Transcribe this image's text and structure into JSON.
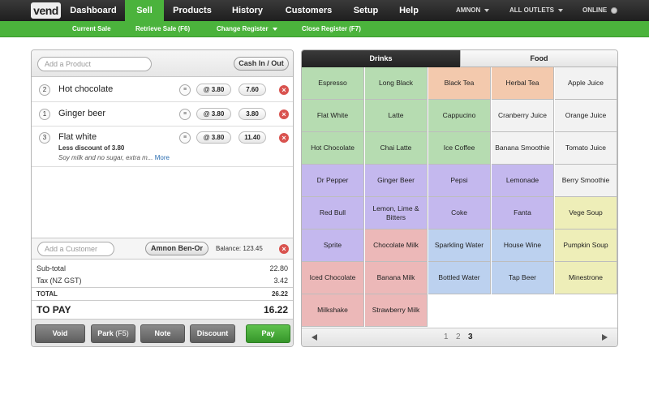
{
  "app": {
    "logo": "vend"
  },
  "nav": {
    "tabs": [
      {
        "label": "Dashboard",
        "active": false
      },
      {
        "label": "Sell",
        "active": true
      },
      {
        "label": "Products",
        "active": false
      },
      {
        "label": "History",
        "active": false
      },
      {
        "label": "Customers",
        "active": false
      },
      {
        "label": "Setup",
        "active": false
      },
      {
        "label": "Help",
        "active": false
      }
    ],
    "user": "AMNON",
    "outlets": "ALL OUTLETS",
    "status": "ONLINE"
  },
  "subnav": {
    "current_sale": "Current Sale",
    "retrieve_sale": "Retrieve Sale (F6)",
    "change_register": "Change Register",
    "close_register": "Close Register (F7)"
  },
  "sale": {
    "product_placeholder": "Add a Product",
    "cash_in_out": "Cash In / Out",
    "lines": [
      {
        "qty": "2",
        "name": "Hot chocolate",
        "unit": "@ 3.80",
        "total": "7.60"
      },
      {
        "qty": "1",
        "name": "Ginger beer",
        "unit": "@ 3.80",
        "total": "3.80"
      },
      {
        "qty": "3",
        "name": "Flat white",
        "unit": "@ 3.80",
        "total": "11.40",
        "discount": "Less discount of 3.80",
        "note": "Soy milk and no sugar, extra m...",
        "more": "More"
      }
    ],
    "customer_placeholder": "Add a Customer",
    "customer": "Amnon Ben-Or",
    "balance": "Balance: 123.45",
    "subtotal_label": "Sub-total",
    "subtotal": "22.80",
    "tax_label": "Tax (NZ GST)",
    "tax": "3.42",
    "total_label": "TOTAL",
    "total": "26.22",
    "topay_label": "TO PAY",
    "topay": "16.22",
    "buttons": {
      "void": "Void",
      "park": "Park",
      "park_key": "(F5)",
      "note": "Note",
      "discount": "Discount",
      "pay": "Pay"
    }
  },
  "quickkeys": {
    "tabs": [
      "Drinks",
      "Food"
    ],
    "colors": {
      "green": "#b6dcb1",
      "orange": "#f3c9ad",
      "white": "#f2f2f2",
      "purple": "#c4b8ee",
      "red": "#ecb8b8",
      "blue": "#bcd1ef",
      "yellow": "#eeeeb8"
    },
    "items": [
      {
        "label": "Espresso",
        "color": "green"
      },
      {
        "label": "Long Black",
        "color": "green"
      },
      {
        "label": "Black Tea",
        "color": "orange"
      },
      {
        "label": "Herbal Tea",
        "color": "orange"
      },
      {
        "label": "Apple Juice",
        "color": "white"
      },
      {
        "label": "Flat White",
        "color": "green"
      },
      {
        "label": "Latte",
        "color": "green"
      },
      {
        "label": "Cappucino",
        "color": "green"
      },
      {
        "label": "Cranberry Juice",
        "color": "white"
      },
      {
        "label": "Orange Juice",
        "color": "white"
      },
      {
        "label": "Hot Chocolate",
        "color": "green"
      },
      {
        "label": "Chai Latte",
        "color": "green"
      },
      {
        "label": "Ice Coffee",
        "color": "green"
      },
      {
        "label": "Banana Smoothie",
        "color": "white"
      },
      {
        "label": "Tomato Juice",
        "color": "white"
      },
      {
        "label": "Dr Pepper",
        "color": "purple"
      },
      {
        "label": "Ginger Beer",
        "color": "purple"
      },
      {
        "label": "Pepsi",
        "color": "purple"
      },
      {
        "label": "Lemonade",
        "color": "purple"
      },
      {
        "label": "Berry Smoothie",
        "color": "white"
      },
      {
        "label": "Red Bull",
        "color": "purple"
      },
      {
        "label": "Lemon, Lime & Bitters",
        "color": "purple"
      },
      {
        "label": "Coke",
        "color": "purple"
      },
      {
        "label": "Fanta",
        "color": "purple"
      },
      {
        "label": "Vege Soup",
        "color": "yellow"
      },
      {
        "label": "Sprite",
        "color": "purple"
      },
      {
        "label": "Chocolate Milk",
        "color": "red"
      },
      {
        "label": "Sparkling Water",
        "color": "blue"
      },
      {
        "label": "House Wine",
        "color": "blue"
      },
      {
        "label": "Pumpkin Soup",
        "color": "yellow"
      },
      {
        "label": "Iced Chocolate",
        "color": "red"
      },
      {
        "label": "Banana Milk",
        "color": "red"
      },
      {
        "label": "Bottled Water",
        "color": "blue"
      },
      {
        "label": "Tap Beer",
        "color": "blue"
      },
      {
        "label": "Minestrone",
        "color": "yellow"
      },
      {
        "label": "Milkshake",
        "color": "red"
      },
      {
        "label": "Strawberry Milk",
        "color": "red"
      }
    ],
    "pages": [
      "1",
      "2",
      "3"
    ],
    "current_page": "3"
  }
}
